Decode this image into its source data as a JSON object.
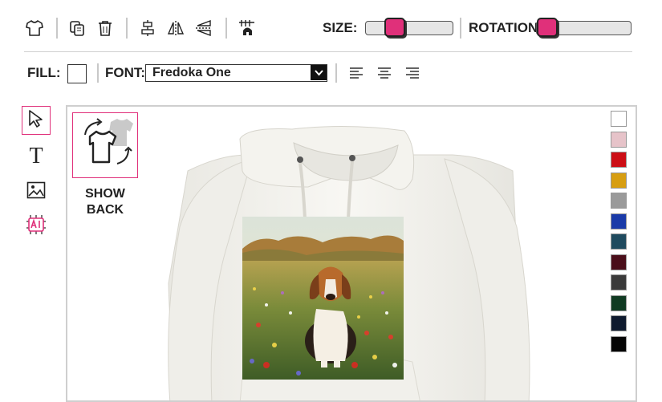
{
  "toolbar": {
    "size_label": "SIZE:",
    "rotation_label": "ROTATION:",
    "size_value": 0.28,
    "rotation_value": 0.0
  },
  "toolbar2": {
    "fill_label": "FILL:",
    "font_label": "FONT:",
    "font_value": "Fredoka One"
  },
  "canvas": {
    "show_back_label_1": "SHOW",
    "show_back_label_2": "BACK"
  },
  "colors": {
    "accent": "#e0307a",
    "swatches": [
      "#ffffff",
      "#e6c3c9",
      "#cc0e16",
      "#d79e12",
      "#9a9a9a",
      "#1a3aa8",
      "#1f4a5e",
      "#4a0e1a",
      "#3a3a3a",
      "#103a22",
      "#0e1a2e",
      "#050505"
    ]
  },
  "icons": {
    "toolbar": [
      "tshirt-icon",
      "duplicate-icon",
      "trash-icon",
      "align-center-icon",
      "flip-horizontal-icon",
      "flip-vertical-icon",
      "layer-icon"
    ],
    "tools": [
      "cursor-icon",
      "text-icon",
      "image-icon",
      "ai-icon"
    ],
    "align": [
      "align-left-icon",
      "align-center-text-icon",
      "align-right-icon"
    ]
  }
}
